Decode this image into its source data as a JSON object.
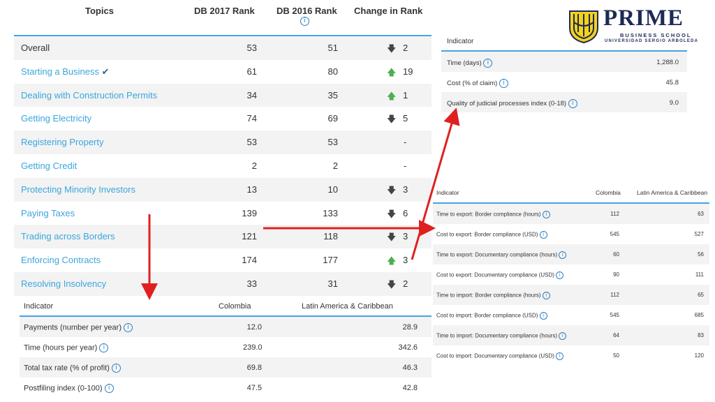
{
  "ranking": {
    "headers": {
      "topics": "Topics",
      "db2017": "DB 2017 Rank",
      "db2016": "DB 2016 Rank",
      "change": "Change in Rank"
    },
    "rows": [
      {
        "topic": "Overall",
        "r2017": "53",
        "r2016": "51",
        "dir": "down",
        "change": "2"
      },
      {
        "topic": "Starting a Business",
        "r2017": "61",
        "r2016": "80",
        "dir": "up",
        "change": "19"
      },
      {
        "topic": "Dealing with Construction Permits",
        "r2017": "34",
        "r2016": "35",
        "dir": "up",
        "change": "1"
      },
      {
        "topic": "Getting Electricity",
        "r2017": "74",
        "r2016": "69",
        "dir": "down",
        "change": "5"
      },
      {
        "topic": "Registering Property",
        "r2017": "53",
        "r2016": "53",
        "dir": "none",
        "change": "-"
      },
      {
        "topic": "Getting Credit",
        "r2017": "2",
        "r2016": "2",
        "dir": "none",
        "change": "-"
      },
      {
        "topic": "Protecting Minority Investors",
        "r2017": "13",
        "r2016": "10",
        "dir": "down",
        "change": "3"
      },
      {
        "topic": "Paying Taxes",
        "r2017": "139",
        "r2016": "133",
        "dir": "down",
        "change": "6"
      },
      {
        "topic": "Trading across Borders",
        "r2017": "121",
        "r2016": "118",
        "dir": "down",
        "change": "3"
      },
      {
        "topic": "Enforcing Contracts",
        "r2017": "174",
        "r2016": "177",
        "dir": "up",
        "change": "3"
      },
      {
        "topic": "Resolving Insolvency",
        "r2017": "33",
        "r2016": "31",
        "dir": "down",
        "change": "2"
      }
    ]
  },
  "taxes": {
    "headers": {
      "indicator": "Indicator",
      "colombia": "Colombia",
      "lac": "Latin America & Caribbean"
    },
    "rows": [
      {
        "indicator": "Payments (number per year)",
        "colombia": "12.0",
        "lac": "28.9"
      },
      {
        "indicator": "Time (hours per year)",
        "colombia": "239.0",
        "lac": "342.6"
      },
      {
        "indicator": "Total tax rate (% of profit)",
        "colombia": "69.8",
        "lac": "46.3"
      },
      {
        "indicator": "Postfiling index (0-100)",
        "colombia": "47.5",
        "lac": "42.8"
      }
    ]
  },
  "contracts": {
    "header": "Indicator",
    "rows": [
      {
        "indicator": "Time (days)",
        "value": "1,288.0"
      },
      {
        "indicator": "Cost (% of claim)",
        "value": "45.8"
      },
      {
        "indicator": "Quality of judicial processes index (0-18)",
        "value": "9.0"
      }
    ]
  },
  "trading": {
    "headers": {
      "indicator": "Indicator",
      "colombia": "Colombia",
      "lac": "Latin America & Caribbean"
    },
    "rows": [
      {
        "indicator": "Time to export: Border compliance (hours)",
        "colombia": "112",
        "lac": "63"
      },
      {
        "indicator": "Cost to export: Border compliance (USD)",
        "colombia": "545",
        "lac": "527"
      },
      {
        "indicator": "Time to export: Documentary compliance (hours)",
        "colombia": "60",
        "lac": "56"
      },
      {
        "indicator": "Cost to export: Documentary compliance (USD)",
        "colombia": "90",
        "lac": "111"
      },
      {
        "indicator": "Time to import: Border compliance (hours)",
        "colombia": "112",
        "lac": "65"
      },
      {
        "indicator": "Cost to import: Border compliance (USD)",
        "colombia": "545",
        "lac": "685"
      },
      {
        "indicator": "Time to import: Documentary compliance (hours)",
        "colombia": "64",
        "lac": "83"
      },
      {
        "indicator": "Cost to import: Documentary compliance (USD)",
        "colombia": "50",
        "lac": "120"
      }
    ]
  },
  "logo": {
    "title": "PRIME",
    "subtitle": "BUSINESS SCHOOL",
    "university": "UNIVERSIDAD SERGIO ARBOLEDA"
  },
  "icons": {
    "info": "info-icon",
    "up": "arrow-up-icon",
    "down": "arrow-down-icon",
    "check": "checkmark-icon"
  },
  "colors": {
    "link": "#3aa6dc",
    "accent_line": "#4aa3df",
    "up": "#4caf50",
    "callout_arrow": "#e02020",
    "brand": "#1c2a55"
  }
}
